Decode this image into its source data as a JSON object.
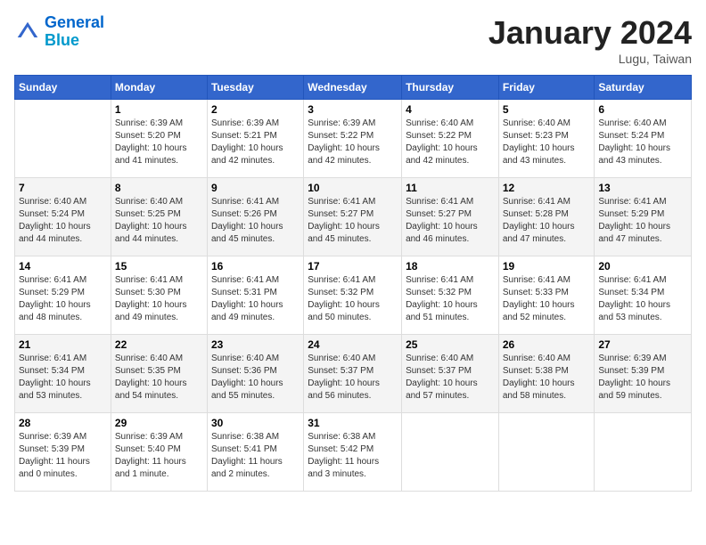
{
  "header": {
    "logo_line1": "General",
    "logo_line2": "Blue",
    "month_year": "January 2024",
    "location": "Lugu, Taiwan"
  },
  "days_of_week": [
    "Sunday",
    "Monday",
    "Tuesday",
    "Wednesday",
    "Thursday",
    "Friday",
    "Saturday"
  ],
  "weeks": [
    [
      {
        "day": "",
        "info": ""
      },
      {
        "day": "1",
        "info": "Sunrise: 6:39 AM\nSunset: 5:20 PM\nDaylight: 10 hours\nand 41 minutes."
      },
      {
        "day": "2",
        "info": "Sunrise: 6:39 AM\nSunset: 5:21 PM\nDaylight: 10 hours\nand 42 minutes."
      },
      {
        "day": "3",
        "info": "Sunrise: 6:39 AM\nSunset: 5:22 PM\nDaylight: 10 hours\nand 42 minutes."
      },
      {
        "day": "4",
        "info": "Sunrise: 6:40 AM\nSunset: 5:22 PM\nDaylight: 10 hours\nand 42 minutes."
      },
      {
        "day": "5",
        "info": "Sunrise: 6:40 AM\nSunset: 5:23 PM\nDaylight: 10 hours\nand 43 minutes."
      },
      {
        "day": "6",
        "info": "Sunrise: 6:40 AM\nSunset: 5:24 PM\nDaylight: 10 hours\nand 43 minutes."
      }
    ],
    [
      {
        "day": "7",
        "info": "Sunrise: 6:40 AM\nSunset: 5:24 PM\nDaylight: 10 hours\nand 44 minutes."
      },
      {
        "day": "8",
        "info": "Sunrise: 6:40 AM\nSunset: 5:25 PM\nDaylight: 10 hours\nand 44 minutes."
      },
      {
        "day": "9",
        "info": "Sunrise: 6:41 AM\nSunset: 5:26 PM\nDaylight: 10 hours\nand 45 minutes."
      },
      {
        "day": "10",
        "info": "Sunrise: 6:41 AM\nSunset: 5:27 PM\nDaylight: 10 hours\nand 45 minutes."
      },
      {
        "day": "11",
        "info": "Sunrise: 6:41 AM\nSunset: 5:27 PM\nDaylight: 10 hours\nand 46 minutes."
      },
      {
        "day": "12",
        "info": "Sunrise: 6:41 AM\nSunset: 5:28 PM\nDaylight: 10 hours\nand 47 minutes."
      },
      {
        "day": "13",
        "info": "Sunrise: 6:41 AM\nSunset: 5:29 PM\nDaylight: 10 hours\nand 47 minutes."
      }
    ],
    [
      {
        "day": "14",
        "info": "Sunrise: 6:41 AM\nSunset: 5:29 PM\nDaylight: 10 hours\nand 48 minutes."
      },
      {
        "day": "15",
        "info": "Sunrise: 6:41 AM\nSunset: 5:30 PM\nDaylight: 10 hours\nand 49 minutes."
      },
      {
        "day": "16",
        "info": "Sunrise: 6:41 AM\nSunset: 5:31 PM\nDaylight: 10 hours\nand 49 minutes."
      },
      {
        "day": "17",
        "info": "Sunrise: 6:41 AM\nSunset: 5:32 PM\nDaylight: 10 hours\nand 50 minutes."
      },
      {
        "day": "18",
        "info": "Sunrise: 6:41 AM\nSunset: 5:32 PM\nDaylight: 10 hours\nand 51 minutes."
      },
      {
        "day": "19",
        "info": "Sunrise: 6:41 AM\nSunset: 5:33 PM\nDaylight: 10 hours\nand 52 minutes."
      },
      {
        "day": "20",
        "info": "Sunrise: 6:41 AM\nSunset: 5:34 PM\nDaylight: 10 hours\nand 53 minutes."
      }
    ],
    [
      {
        "day": "21",
        "info": "Sunrise: 6:41 AM\nSunset: 5:34 PM\nDaylight: 10 hours\nand 53 minutes."
      },
      {
        "day": "22",
        "info": "Sunrise: 6:40 AM\nSunset: 5:35 PM\nDaylight: 10 hours\nand 54 minutes."
      },
      {
        "day": "23",
        "info": "Sunrise: 6:40 AM\nSunset: 5:36 PM\nDaylight: 10 hours\nand 55 minutes."
      },
      {
        "day": "24",
        "info": "Sunrise: 6:40 AM\nSunset: 5:37 PM\nDaylight: 10 hours\nand 56 minutes."
      },
      {
        "day": "25",
        "info": "Sunrise: 6:40 AM\nSunset: 5:37 PM\nDaylight: 10 hours\nand 57 minutes."
      },
      {
        "day": "26",
        "info": "Sunrise: 6:40 AM\nSunset: 5:38 PM\nDaylight: 10 hours\nand 58 minutes."
      },
      {
        "day": "27",
        "info": "Sunrise: 6:39 AM\nSunset: 5:39 PM\nDaylight: 10 hours\nand 59 minutes."
      }
    ],
    [
      {
        "day": "28",
        "info": "Sunrise: 6:39 AM\nSunset: 5:39 PM\nDaylight: 11 hours\nand 0 minutes."
      },
      {
        "day": "29",
        "info": "Sunrise: 6:39 AM\nSunset: 5:40 PM\nDaylight: 11 hours\nand 1 minute."
      },
      {
        "day": "30",
        "info": "Sunrise: 6:38 AM\nSunset: 5:41 PM\nDaylight: 11 hours\nand 2 minutes."
      },
      {
        "day": "31",
        "info": "Sunrise: 6:38 AM\nSunset: 5:42 PM\nDaylight: 11 hours\nand 3 minutes."
      },
      {
        "day": "",
        "info": ""
      },
      {
        "day": "",
        "info": ""
      },
      {
        "day": "",
        "info": ""
      }
    ]
  ]
}
